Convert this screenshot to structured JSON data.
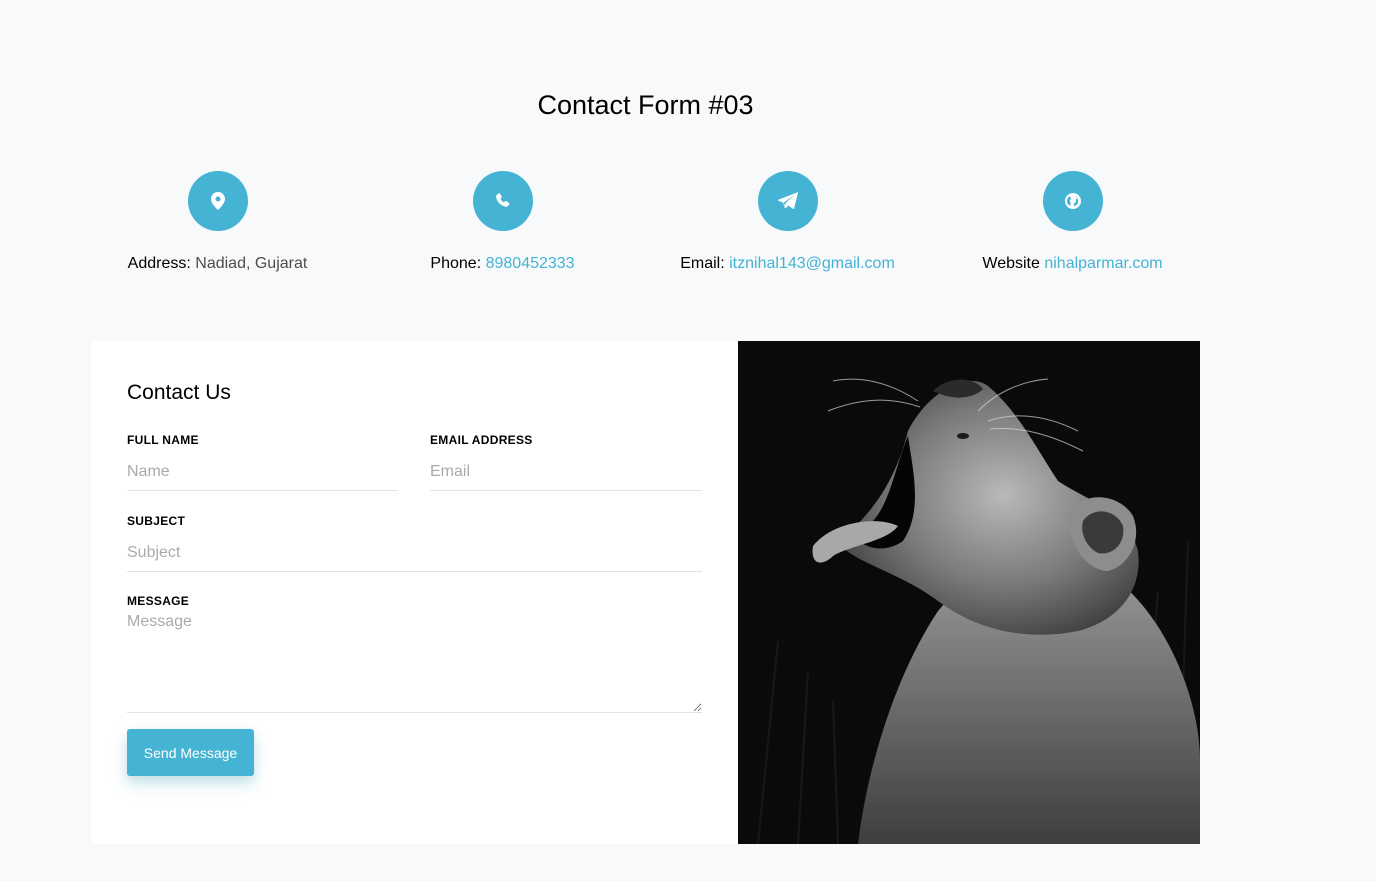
{
  "page_title": "Contact Form #03",
  "info": [
    {
      "icon": "map-pin-icon",
      "label": "Address:",
      "value": "Nadiad, Gujarat",
      "is_link": false
    },
    {
      "icon": "phone-icon",
      "label": "Phone:",
      "value": "8980452333",
      "is_link": true
    },
    {
      "icon": "paper-plane-icon",
      "label": "Email:",
      "value": "itznihal143@gmail.com",
      "is_link": true
    },
    {
      "icon": "globe-icon",
      "label": "Website",
      "value": "nihalparmar.com",
      "is_link": true
    }
  ],
  "form": {
    "title": "Contact Us",
    "full_name": {
      "label": "FULL NAME",
      "placeholder": "Name",
      "value": ""
    },
    "email": {
      "label": "EMAIL ADDRESS",
      "placeholder": "Email",
      "value": ""
    },
    "subject": {
      "label": "SUBJECT",
      "placeholder": "Subject",
      "value": ""
    },
    "message": {
      "label": "MESSAGE",
      "placeholder": "Message",
      "value": ""
    },
    "submit_label": "Send Message"
  },
  "colors": {
    "accent": "#45b3d3",
    "background": "#f8f9fa",
    "card": "#ffffff"
  }
}
